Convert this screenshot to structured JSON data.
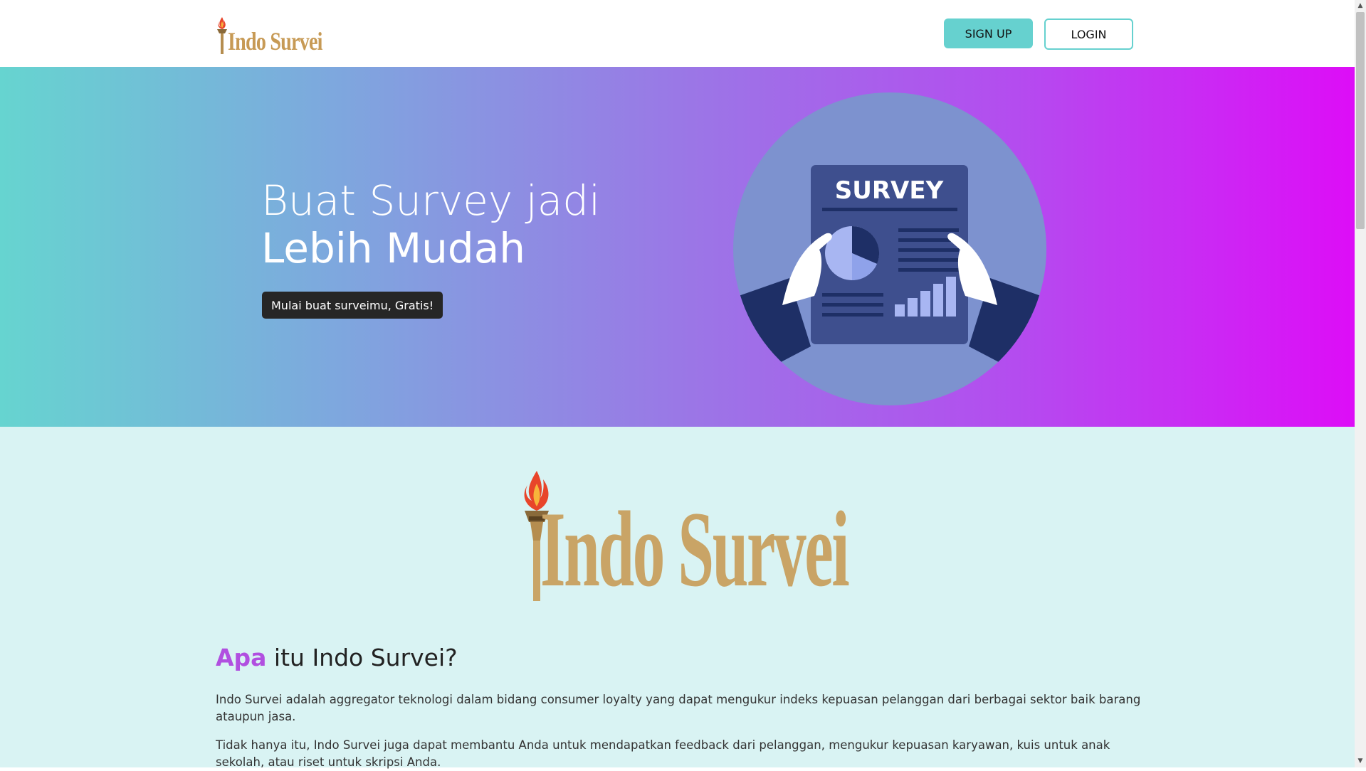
{
  "brand": {
    "name": "Indo Survei"
  },
  "nav": {
    "signup_label": "SIGN UP",
    "login_label": "LOGIN"
  },
  "hero": {
    "title_line1": "Buat Survey jadi",
    "title_line2": "Lebih Mudah",
    "cta_label": "Mulai buat surveimu, Gratis!",
    "illustration_text": "SURVEY"
  },
  "about": {
    "logo_text": "Indo Survei",
    "heading_accent": "Apa",
    "heading_rest": " itu Indo Survei?",
    "paragraph1": "Indo Survei adalah aggregator teknologi dalam bidang consumer loyalty yang dapat mengukur indeks kepuasan pelanggan dari berbagai sektor baik barang ataupun jasa.",
    "paragraph2": "Tidak hanya itu, Indo Survei juga dapat membantu Anda untuk mendapatkan feedback dari pelanggan, mengukur kepuasan karyawan, kuis untuk anak sekolah, atau riset untuk skripsi Anda."
  },
  "colors": {
    "accent_teal": "#66d1cf",
    "accent_purple": "#b14fe0",
    "gold": "#c9a466",
    "hero_gradient_start": "#66d4d0",
    "hero_gradient_end": "#dd0df7",
    "about_bg": "#d9f3f3"
  },
  "icons": [
    "torch-logo-icon",
    "survey-illustration",
    "scroll-up-arrow-icon",
    "scroll-down-arrow-icon"
  ]
}
